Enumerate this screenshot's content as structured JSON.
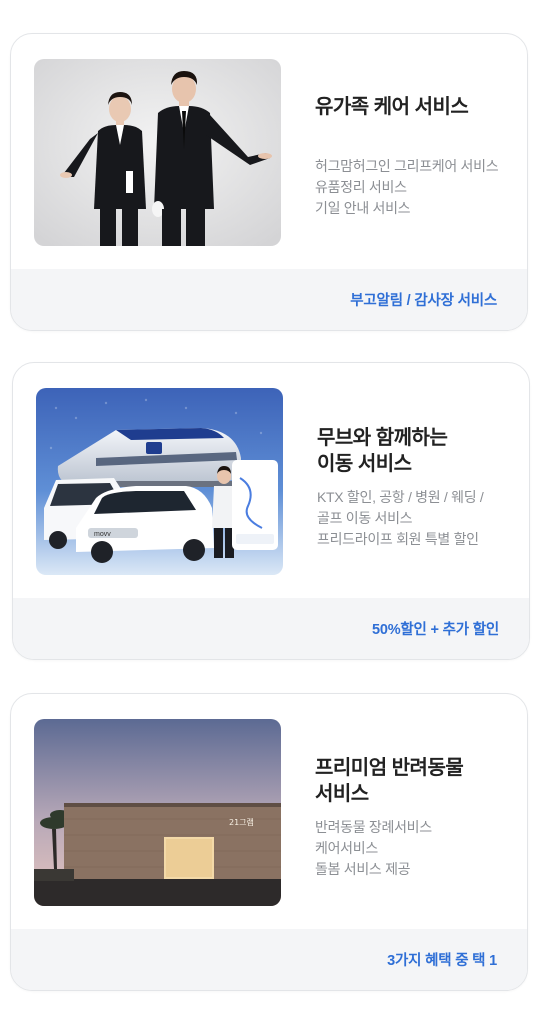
{
  "services": [
    {
      "title": "유가족 케어 서비스",
      "lines": [
        "허그맘허그인 그리프케어 서비스",
        "유품정리 서비스",
        "기일 안내 서비스"
      ],
      "footer_link": "부고알림 / 감사장 서비스",
      "image": "two-staff-in-black-suits"
    },
    {
      "title": "무브와 함께하는\n이동 서비스",
      "lines": [
        "KTX 할인, 공항 / 병원 / 웨딩 /",
        "골프 이동 서비스",
        "프리드라이프 회원 특별 할인"
      ],
      "footer_link": "50%할인 + 추가 할인",
      "image": "ktx-train-and-vans",
      "brand_marks": [
        "movv"
      ]
    },
    {
      "title": "프리미엄 반려동물\n서비스",
      "lines": [
        "반려동물 장례서비스",
        "케어서비스",
        "돌봄 서비스 제공"
      ],
      "footer_link": "3가지 혜택 중 택 1",
      "image": "pet-funeral-building-at-dusk",
      "brand_marks": [
        "21그램"
      ]
    }
  ],
  "colors": {
    "accent": "#2f6fd6",
    "title": "#222222",
    "description": "#8c8f94",
    "footer_bg": "#f4f5f7"
  }
}
